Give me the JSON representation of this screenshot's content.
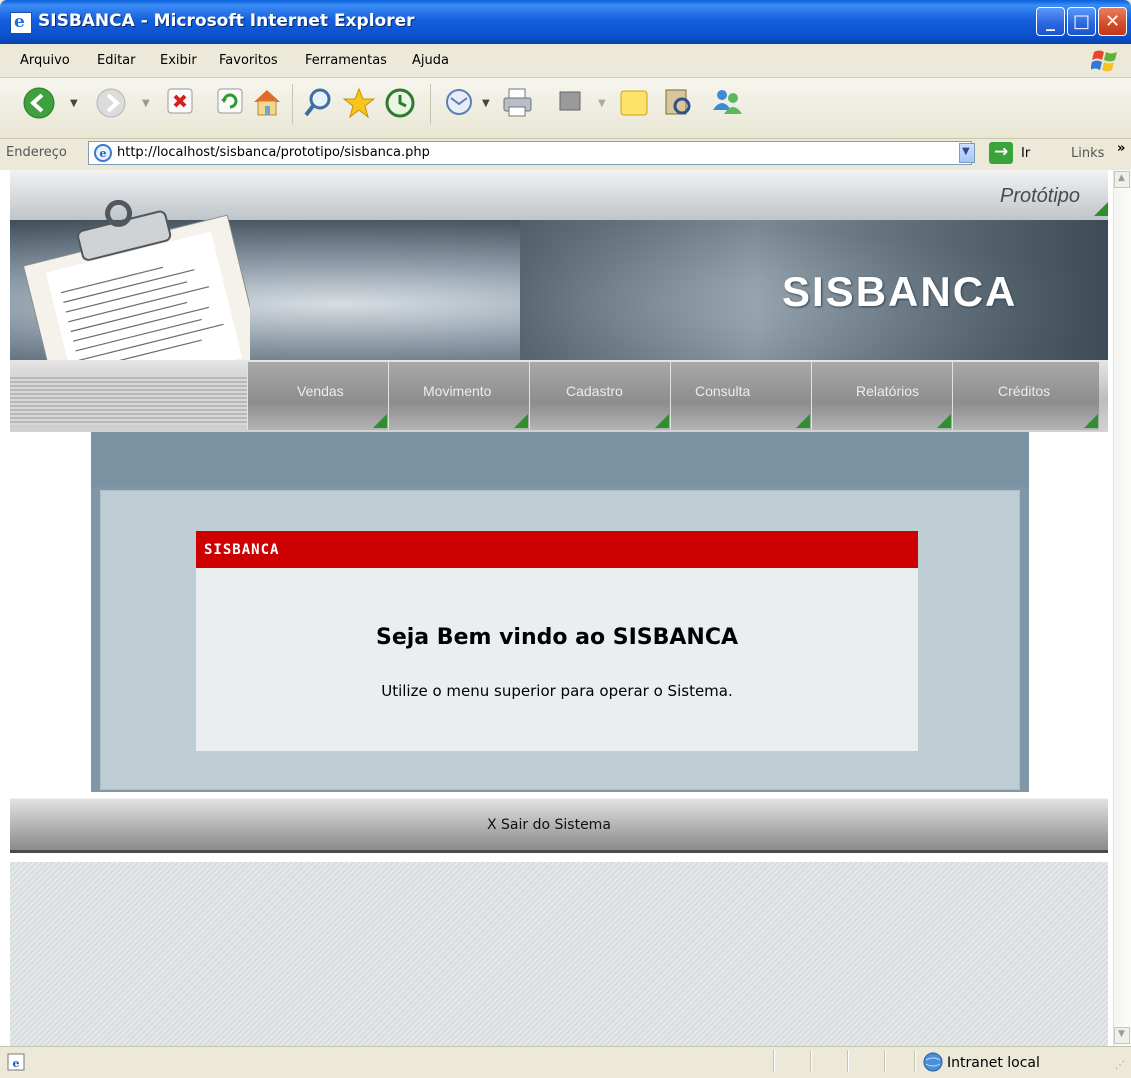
{
  "window": {
    "title": "SISBANCA - Microsoft Internet Explorer"
  },
  "menu": [
    "Arquivo",
    "Editar",
    "Exibir",
    "Favoritos",
    "Ferramentas",
    "Ajuda"
  ],
  "address_bar": {
    "label": "Endereço",
    "url": "http://localhost/sisbanca/prototipo/sisbanca.php",
    "go_label": "Ir",
    "links_label": "Links"
  },
  "banner": {
    "tagline": "Protótipo",
    "brand": "SISBANCA"
  },
  "nav": [
    "Vendas",
    "Movimento",
    "Cadastro",
    "Consulta",
    "Relatórios",
    "Créditos"
  ],
  "card": {
    "header": "SISBANCA",
    "title": "Seja Bem vindo ao SISBANCA",
    "message": "Utilize o menu superior para operar o Sistema."
  },
  "footer": {
    "logout": "X Sair do Sistema"
  },
  "status": {
    "zone": "Intranet local"
  },
  "colors": {
    "accent_red": "#cc0000",
    "panel_blue": "#bfcdd4",
    "xp_title": "#0a4fc8"
  }
}
